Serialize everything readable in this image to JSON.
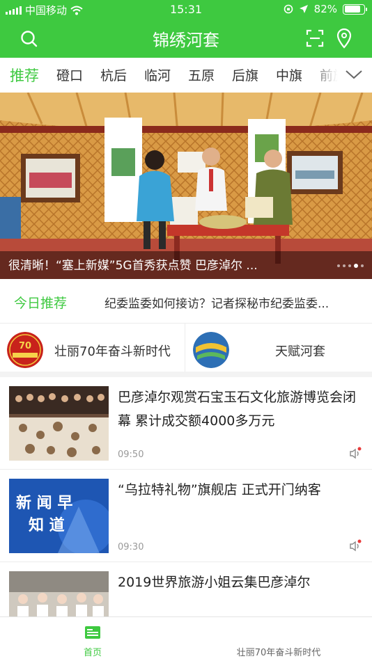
{
  "status_bar": {
    "carrier": "中国移动",
    "time": "15:31",
    "battery": "82%",
    "battery_level": 0.82
  },
  "header": {
    "title": "锦绣河套",
    "icons": [
      "search-icon",
      "scan-icon",
      "location-icon"
    ]
  },
  "tabs": [
    {
      "label": "推荐",
      "active": true
    },
    {
      "label": "磴口"
    },
    {
      "label": "杭后"
    },
    {
      "label": "临河"
    },
    {
      "label": "五原"
    },
    {
      "label": "后旗"
    },
    {
      "label": "中旗"
    },
    {
      "label": "前旗"
    }
  ],
  "banner": {
    "caption": "很清晰！“塞上新媒”5G首秀获点赞  巴彦淖尔 ...",
    "dot_count": 5,
    "active_dot": 3
  },
  "today": {
    "label": "今日推荐",
    "text": "纪委监委如何接访？记者探秘市纪委监委..."
  },
  "topics": [
    {
      "name": "壮丽70年奋斗新时代"
    },
    {
      "name": "天赋河套"
    }
  ],
  "news": [
    {
      "headline": "巴彦淖尔观赏石宝玉石文化旅游博览会闭幕  累计成交额4000多万元",
      "time": "09:50"
    },
    {
      "headline": "“乌拉特礼物”旗舰店 正式开门纳客",
      "time": "09:30"
    },
    {
      "headline": "2019世界旅游小姐云集巴彦淖尔",
      "time": ""
    }
  ],
  "bottom_nav": {
    "home": "首页",
    "topic": "壮丽70年奋斗新时代"
  },
  "colors": {
    "brand_green": "#3ec940",
    "text": "#222222",
    "muted": "#999999",
    "badge_red": "#e83b3b"
  }
}
